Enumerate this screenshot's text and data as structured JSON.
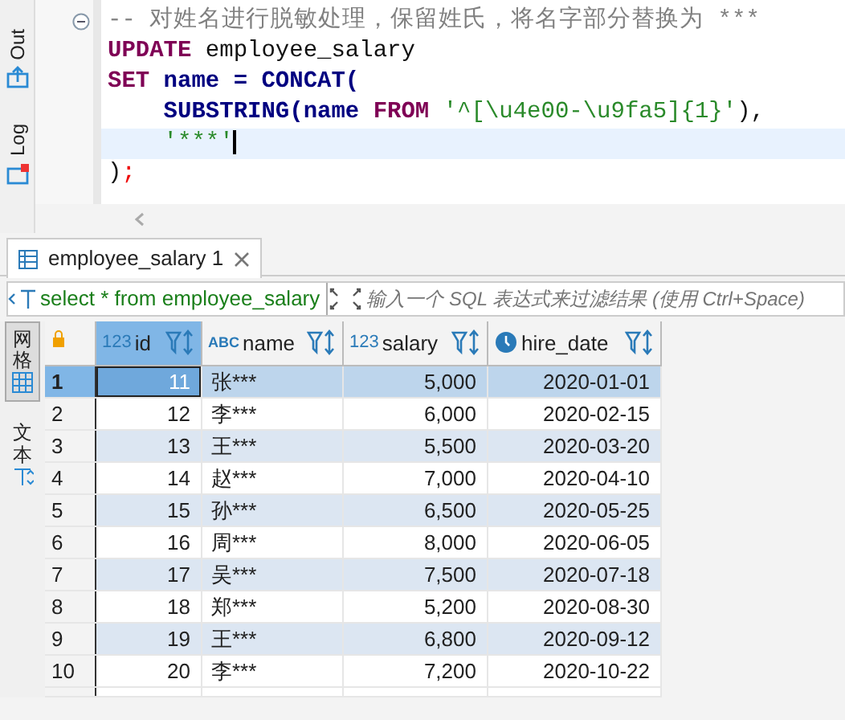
{
  "side_tabs": [
    {
      "label": "Out",
      "kind": "out"
    },
    {
      "label": "Log",
      "kind": "log"
    }
  ],
  "editor": {
    "lines": [
      {
        "foldable": true,
        "current": false,
        "tokens": [
          {
            "text": "-- 对姓名进行脱敏处理，保留姓氏，将名字部分替换为 ***",
            "kind": "comment"
          }
        ]
      },
      {
        "foldable": false,
        "current": false,
        "tokens": [
          {
            "text": "UPDATE",
            "kind": "keyword"
          },
          {
            "text": " employee_salary",
            "kind": "plain"
          }
        ]
      },
      {
        "foldable": false,
        "current": false,
        "tokens": [
          {
            "text": "SET",
            "kind": "keyword"
          },
          {
            "text": " name = CONCAT(",
            "kind": "function"
          }
        ]
      },
      {
        "foldable": false,
        "current": false,
        "tokens": [
          {
            "text": "    SUBSTRING(name ",
            "kind": "function"
          },
          {
            "text": "FROM",
            "kind": "keyword"
          },
          {
            "text": " '^[\\u4e00-\\u9fa5]{1}'",
            "kind": "string"
          },
          {
            "text": "),",
            "kind": "plain"
          }
        ]
      },
      {
        "foldable": false,
        "current": true,
        "tokens": [
          {
            "text": "    '***'",
            "kind": "string"
          }
        ]
      },
      {
        "foldable": false,
        "current": false,
        "tokens": [
          {
            "text": ")",
            "kind": "plain"
          },
          {
            "text": ";",
            "kind": "semicolon"
          }
        ]
      }
    ]
  },
  "result_tab": {
    "title": "employee_salary 1"
  },
  "filter": {
    "query": "select * from employee_salary",
    "placeholder": "输入一个 SQL 表达式来过滤结果 (使用 Ctrl+Space)"
  },
  "view_tabs": [
    {
      "label": "网格",
      "selected": true
    },
    {
      "label": "文本",
      "selected": false
    }
  ],
  "table": {
    "columns": [
      {
        "name": "id",
        "kind": "number",
        "type_label": "123",
        "selected": true
      },
      {
        "name": "name",
        "kind": "text",
        "type_label": "ABC",
        "selected": false
      },
      {
        "name": "salary",
        "kind": "number",
        "type_label": "123",
        "selected": false
      },
      {
        "name": "hire_date",
        "kind": "date",
        "selected": false
      }
    ],
    "rows": [
      {
        "number": "1",
        "selected": true,
        "cells": [
          "11",
          "张***",
          "5,000",
          "2020-01-01"
        ]
      },
      {
        "number": "2",
        "selected": false,
        "cells": [
          "12",
          "李***",
          "6,000",
          "2020-02-15"
        ]
      },
      {
        "number": "3",
        "selected": false,
        "cells": [
          "13",
          "王***",
          "5,500",
          "2020-03-20"
        ]
      },
      {
        "number": "4",
        "selected": false,
        "cells": [
          "14",
          "赵***",
          "7,000",
          "2020-04-10"
        ]
      },
      {
        "number": "5",
        "selected": false,
        "cells": [
          "15",
          "孙***",
          "6,500",
          "2020-05-25"
        ]
      },
      {
        "number": "6",
        "selected": false,
        "cells": [
          "16",
          "周***",
          "8,000",
          "2020-06-05"
        ]
      },
      {
        "number": "7",
        "selected": false,
        "cells": [
          "17",
          "吴***",
          "7,500",
          "2020-07-18"
        ]
      },
      {
        "number": "8",
        "selected": false,
        "cells": [
          "18",
          "郑***",
          "5,200",
          "2020-08-30"
        ]
      },
      {
        "number": "9",
        "selected": false,
        "cells": [
          "19",
          "王***",
          "6,800",
          "2020-09-12"
        ]
      },
      {
        "number": "10",
        "selected": false,
        "cells": [
          "20",
          "李***",
          "7,200",
          "2020-10-22"
        ]
      }
    ]
  }
}
